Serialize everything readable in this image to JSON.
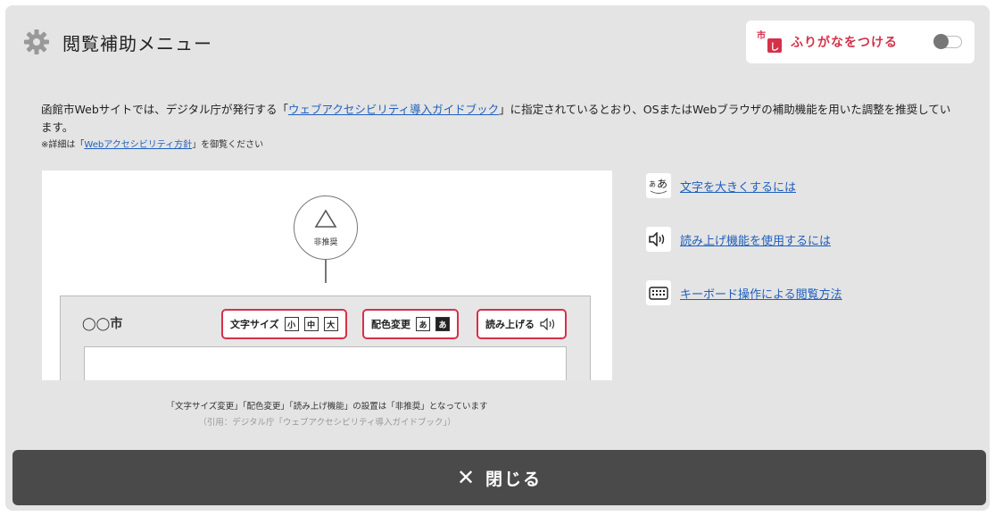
{
  "header": {
    "title": "閲覧補助メニュー",
    "icon": "gear-icon"
  },
  "furigana": {
    "label": "ふりがなをつける",
    "icon_top": "市",
    "icon_bottom": "し",
    "enabled": false,
    "accent_color": "#d6304a"
  },
  "intro": {
    "text_before": "函館市Webサイトでは、デジタル庁が発行する「",
    "link": "ウェブアクセシビリティ導入ガイドブック",
    "text_after": "」に指定されているとおり、OSまたはWebブラウザの補助機能を用いた調整を推奨しています。",
    "note_before": "※詳細は「",
    "note_link": "Webアクセシビリティ方針",
    "note_after": "」を御覧ください"
  },
  "illustration": {
    "bubble_label": "非推奨",
    "city": "◯◯市",
    "text_size_label": "文字サイズ",
    "size_small": "小",
    "size_medium": "中",
    "size_large": "大",
    "color_change_label": "配色変更",
    "color_light": "あ",
    "color_dark": "あ",
    "read_aloud_label": "読み上げる",
    "caption": "「文字サイズ変更」「配色変更」「読み上げ機能」の設置は「非推奨」となっています",
    "citation": "（引用：デジタル庁「ウェブアクセシビリティ導入ガイドブック」）"
  },
  "help_links": [
    {
      "label": "文字を大きくするには",
      "icon": "text-size-icon"
    },
    {
      "label": "読み上げ機能を使用するには",
      "icon": "speaker-icon"
    },
    {
      "label": "キーボード操作による閲覧方法",
      "icon": "keyboard-icon"
    }
  ],
  "close": {
    "label": "閉じる",
    "icon": "close-icon"
  },
  "colors": {
    "panel_bg": "#e4e4e4",
    "link": "#1f5fbd",
    "close_bar": "#4a4a4a"
  }
}
